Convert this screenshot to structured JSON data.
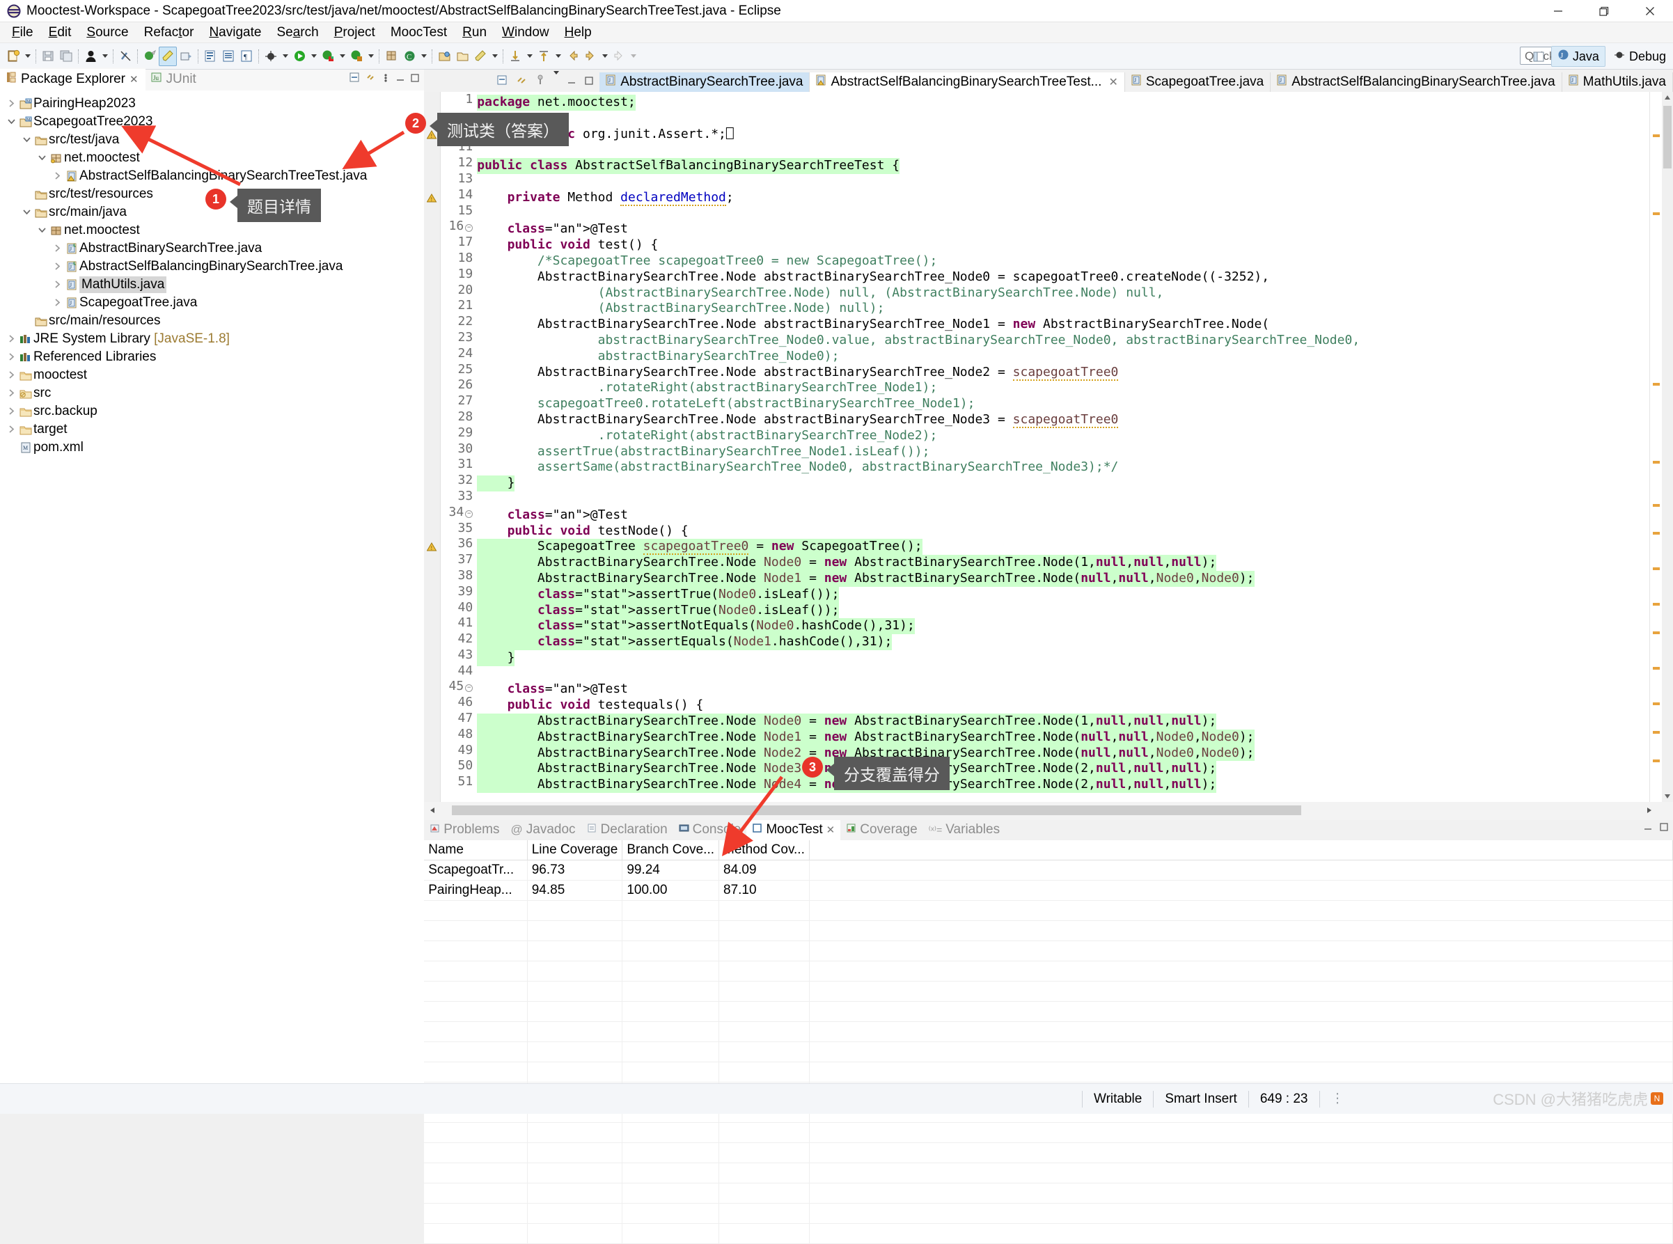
{
  "window": {
    "title": "Mooctest-Workspace - ScapegoatTree2023/src/test/java/net/mooctest/AbstractSelfBalancingBinarySearchTreeTest.java - Eclipse",
    "app_icon": "eclipse-icon",
    "minimize_label": "minimize-icon",
    "maximize_label": "maximize-icon",
    "close_label": "close-icon"
  },
  "menubar": {
    "items": [
      {
        "label": "File",
        "accel": "F"
      },
      {
        "label": "Edit",
        "accel": "E"
      },
      {
        "label": "Source",
        "accel": "S"
      },
      {
        "label": "Refactor",
        "accel": "t"
      },
      {
        "label": "Navigate",
        "accel": "N"
      },
      {
        "label": "Search",
        "accel": "a"
      },
      {
        "label": "Project",
        "accel": "P"
      },
      {
        "label": "MoocTest",
        "accel": ""
      },
      {
        "label": "Run",
        "accel": "R"
      },
      {
        "label": "Window",
        "accel": "W"
      },
      {
        "label": "Help",
        "accel": "H"
      }
    ]
  },
  "toolbar": {
    "quick_access_placeholder": "Quick Access",
    "perspectives": [
      {
        "label": "Java",
        "active": true,
        "icon": "java-perspective-icon"
      },
      {
        "label": "Debug",
        "active": false,
        "icon": "debug-perspective-icon"
      }
    ]
  },
  "left_pane": {
    "tabs": [
      {
        "label": "Package Explorer",
        "icon": "package-explorer-icon",
        "active": true,
        "closeable": true
      },
      {
        "label": "JUnit",
        "icon": "junit-icon",
        "active": false,
        "closeable": false
      }
    ],
    "tree": [
      {
        "indent": 0,
        "twist": "collapsed",
        "icon": "java-project-icon",
        "label": "PairingHeap2023",
        "selected": false
      },
      {
        "indent": 0,
        "twist": "expanded",
        "icon": "java-project-icon",
        "label": "ScapegoatTree2023",
        "selected": false
      },
      {
        "indent": 1,
        "twist": "expanded",
        "icon": "source-folder-icon",
        "label": "src/test/java",
        "selected": false
      },
      {
        "indent": 2,
        "twist": "expanded",
        "icon": "package-icon-test",
        "label": "net.mooctest",
        "selected": false
      },
      {
        "indent": 3,
        "twist": "collapsed",
        "icon": "java-file-warn-icon",
        "label": "AbstractSelfBalancingBinarySearchTreeTest.java",
        "selected": false
      },
      {
        "indent": 1,
        "twist": "none",
        "icon": "source-folder-icon",
        "label": "src/test/resources",
        "selected": false
      },
      {
        "indent": 1,
        "twist": "expanded",
        "icon": "source-folder-icon",
        "label": "src/main/java",
        "selected": false
      },
      {
        "indent": 2,
        "twist": "expanded",
        "icon": "package-icon",
        "label": "net.mooctest",
        "selected": false
      },
      {
        "indent": 3,
        "twist": "collapsed",
        "icon": "java-abstract-file-icon",
        "label": "AbstractBinarySearchTree.java",
        "selected": false
      },
      {
        "indent": 3,
        "twist": "collapsed",
        "icon": "java-abstract-file-icon",
        "label": "AbstractSelfBalancingBinarySearchTree.java",
        "selected": false
      },
      {
        "indent": 3,
        "twist": "collapsed",
        "icon": "java-file-icon",
        "label": "MathUtils.java",
        "selected": true
      },
      {
        "indent": 3,
        "twist": "collapsed",
        "icon": "java-file-icon",
        "label": "ScapegoatTree.java",
        "selected": false
      },
      {
        "indent": 1,
        "twist": "none",
        "icon": "source-folder-icon",
        "label": "src/main/resources",
        "selected": false
      },
      {
        "indent": 0,
        "twist": "collapsed",
        "icon": "library-icon",
        "label": "JRE System Library",
        "suffix": "[JavaSE-1.8]",
        "selected": false
      },
      {
        "indent": 0,
        "twist": "collapsed",
        "icon": "library-icon",
        "label": "Referenced Libraries",
        "selected": false
      },
      {
        "indent": 0,
        "twist": "collapsed",
        "icon": "folder-icon",
        "label": "mooctest",
        "selected": false
      },
      {
        "indent": 0,
        "twist": "collapsed",
        "icon": "folder-excluded-icon",
        "label": "src",
        "selected": false
      },
      {
        "indent": 0,
        "twist": "collapsed",
        "icon": "folder-icon",
        "label": "src.backup",
        "selected": false
      },
      {
        "indent": 0,
        "twist": "collapsed",
        "icon": "folder-icon",
        "label": "target",
        "selected": false
      },
      {
        "indent": 0,
        "twist": "none",
        "icon": "maven-pom-icon",
        "label": "pom.xml",
        "selected": false
      }
    ]
  },
  "editor": {
    "tabs": [
      {
        "label": "AbstractBinarySearchTree.java",
        "icon": "java-file-icon",
        "state": "selected-inactive",
        "closeable": false
      },
      {
        "label": "AbstractSelfBalancingBinarySearchTreeTest...",
        "icon": "java-file-warn-icon",
        "state": "active",
        "closeable": true
      },
      {
        "label": "ScapegoatTree.java",
        "icon": "java-file-icon",
        "state": "normal",
        "closeable": false
      },
      {
        "label": "AbstractSelfBalancingBinarySearchTree.java",
        "icon": "java-file-icon",
        "state": "normal",
        "closeable": false
      },
      {
        "label": "MathUtils.java",
        "icon": "java-file-icon",
        "state": "normal",
        "closeable": false
      }
    ],
    "lines": [
      {
        "n": "1",
        "fold": "",
        "mark": "",
        "hl": true,
        "code": "package net.mooctest;"
      },
      {
        "n": "",
        "fold": "",
        "mark": "",
        "hl": false,
        "code": ""
      },
      {
        "n": "3",
        "fold": "+",
        "mark": "warn",
        "hl": false,
        "code": "import static org.junit.Assert.*;⎕"
      },
      {
        "n": "11",
        "fold": "",
        "mark": "",
        "hl": false,
        "code": ""
      },
      {
        "n": "12",
        "fold": "",
        "mark": "",
        "hl": true,
        "code": "public class AbstractSelfBalancingBinarySearchTreeTest {"
      },
      {
        "n": "13",
        "fold": "",
        "mark": "",
        "hl": false,
        "code": ""
      },
      {
        "n": "14",
        "fold": "",
        "mark": "warn",
        "hl": false,
        "code": "    private Method declaredMethod;"
      },
      {
        "n": "15",
        "fold": "",
        "mark": "",
        "hl": false,
        "code": ""
      },
      {
        "n": "16",
        "fold": "-",
        "mark": "",
        "hl": false,
        "code": "    @Test"
      },
      {
        "n": "17",
        "fold": "",
        "mark": "",
        "hl": false,
        "code": "    public void test() {"
      },
      {
        "n": "18",
        "fold": "",
        "mark": "",
        "hl": false,
        "code": "        /*ScapegoatTree scapegoatTree0 = new ScapegoatTree();"
      },
      {
        "n": "19",
        "fold": "",
        "mark": "",
        "hl": false,
        "code": "        AbstractBinarySearchTree.Node abstractBinarySearchTree_Node0 = scapegoatTree0.createNode((-3252),"
      },
      {
        "n": "20",
        "fold": "",
        "mark": "",
        "hl": false,
        "code": "                (AbstractBinarySearchTree.Node) null, (AbstractBinarySearchTree.Node) null,"
      },
      {
        "n": "21",
        "fold": "",
        "mark": "",
        "hl": false,
        "code": "                (AbstractBinarySearchTree.Node) null);"
      },
      {
        "n": "22",
        "fold": "",
        "mark": "",
        "hl": false,
        "code": "        AbstractBinarySearchTree.Node abstractBinarySearchTree_Node1 = new AbstractBinarySearchTree.Node("
      },
      {
        "n": "23",
        "fold": "",
        "mark": "",
        "hl": false,
        "code": "                abstractBinarySearchTree_Node0.value, abstractBinarySearchTree_Node0, abstractBinarySearchTree_Node0,"
      },
      {
        "n": "24",
        "fold": "",
        "mark": "",
        "hl": false,
        "code": "                abstractBinarySearchTree_Node0);"
      },
      {
        "n": "25",
        "fold": "",
        "mark": "",
        "hl": false,
        "code": "        AbstractBinarySearchTree.Node abstractBinarySearchTree_Node2 = scapegoatTree0"
      },
      {
        "n": "26",
        "fold": "",
        "mark": "",
        "hl": false,
        "code": "                .rotateRight(abstractBinarySearchTree_Node1);"
      },
      {
        "n": "27",
        "fold": "",
        "mark": "",
        "hl": false,
        "code": "        scapegoatTree0.rotateLeft(abstractBinarySearchTree_Node1);"
      },
      {
        "n": "28",
        "fold": "",
        "mark": "",
        "hl": false,
        "code": "        AbstractBinarySearchTree.Node abstractBinarySearchTree_Node3 = scapegoatTree0"
      },
      {
        "n": "29",
        "fold": "",
        "mark": "",
        "hl": false,
        "code": "                .rotateRight(abstractBinarySearchTree_Node2);"
      },
      {
        "n": "30",
        "fold": "",
        "mark": "",
        "hl": false,
        "code": "        assertTrue(abstractBinarySearchTree_Node1.isLeaf());"
      },
      {
        "n": "31",
        "fold": "",
        "mark": "",
        "hl": false,
        "code": "        assertSame(abstractBinarySearchTree_Node0, abstractBinarySearchTree_Node3);*/"
      },
      {
        "n": "32",
        "fold": "",
        "mark": "",
        "hl": true,
        "code": "    }"
      },
      {
        "n": "33",
        "fold": "",
        "mark": "",
        "hl": false,
        "code": ""
      },
      {
        "n": "34",
        "fold": "-",
        "mark": "",
        "hl": false,
        "code": "    @Test"
      },
      {
        "n": "35",
        "fold": "",
        "mark": "",
        "hl": false,
        "code": "    public void testNode() {"
      },
      {
        "n": "36",
        "fold": "",
        "mark": "warn",
        "hl": true,
        "code": "        ScapegoatTree scapegoatTree0 = new ScapegoatTree();"
      },
      {
        "n": "37",
        "fold": "",
        "mark": "",
        "hl": true,
        "code": "        AbstractBinarySearchTree.Node Node0 = new AbstractBinarySearchTree.Node(1,null,null,null);"
      },
      {
        "n": "38",
        "fold": "",
        "mark": "",
        "hl": true,
        "code": "        AbstractBinarySearchTree.Node Node1 = new AbstractBinarySearchTree.Node(null,null,Node0,Node0);"
      },
      {
        "n": "39",
        "fold": "",
        "mark": "",
        "hl": true,
        "code": "        assertTrue(Node0.isLeaf());"
      },
      {
        "n": "40",
        "fold": "",
        "mark": "",
        "hl": true,
        "code": "        assertTrue(Node0.isLeaf());"
      },
      {
        "n": "41",
        "fold": "",
        "mark": "",
        "hl": true,
        "code": "        assertNotEquals(Node0.hashCode(),31);"
      },
      {
        "n": "42",
        "fold": "",
        "mark": "",
        "hl": true,
        "code": "        assertEquals(Node1.hashCode(),31);"
      },
      {
        "n": "43",
        "fold": "",
        "mark": "",
        "hl": true,
        "code": "    }"
      },
      {
        "n": "44",
        "fold": "",
        "mark": "",
        "hl": false,
        "code": ""
      },
      {
        "n": "45",
        "fold": "-",
        "mark": "",
        "hl": false,
        "code": "    @Test"
      },
      {
        "n": "46",
        "fold": "",
        "mark": "",
        "hl": false,
        "code": "    public void testequals() {"
      },
      {
        "n": "47",
        "fold": "",
        "mark": "",
        "hl": true,
        "code": "        AbstractBinarySearchTree.Node Node0 = new AbstractBinarySearchTree.Node(1,null,null,null);"
      },
      {
        "n": "48",
        "fold": "",
        "mark": "",
        "hl": true,
        "code": "        AbstractBinarySearchTree.Node Node1 = new AbstractBinarySearchTree.Node(null,null,Node0,Node0);"
      },
      {
        "n": "49",
        "fold": "",
        "mark": "",
        "hl": true,
        "code": "        AbstractBinarySearchTree.Node Node2 = new AbstractBinarySearchTree.Node(null,null,Node0,Node0);"
      },
      {
        "n": "50",
        "fold": "",
        "mark": "",
        "hl": true,
        "code": "        AbstractBinarySearchTree.Node Node3 = new AbstractBinarySearchTree.Node(2,null,null,null);"
      },
      {
        "n": "51",
        "fold": "",
        "mark": "",
        "hl": true,
        "code": "        AbstractBinarySearchTree.Node Node4 = new AbstractBinarySearchTree.Node(2,null,null,null);"
      }
    ]
  },
  "bottom_pane": {
    "tabs": [
      {
        "label": "Problems",
        "icon": "problems-icon",
        "active": false,
        "closeable": false
      },
      {
        "label": "Javadoc",
        "icon": "javadoc-icon",
        "active": false,
        "closeable": false
      },
      {
        "label": "Declaration",
        "icon": "declaration-icon",
        "active": false,
        "closeable": false
      },
      {
        "label": "Console",
        "icon": "console-icon",
        "active": false,
        "closeable": false
      },
      {
        "label": "MoocTest",
        "icon": "mooctest-icon",
        "active": true,
        "closeable": true
      },
      {
        "label": "Coverage",
        "icon": "coverage-icon",
        "active": false,
        "closeable": false
      },
      {
        "label": "Variables",
        "icon": "variables-icon",
        "active": false,
        "closeable": false
      }
    ],
    "table": {
      "columns": [
        "Name",
        "Line Coverage",
        "Branch Cove...",
        "Method Cov...",
        ""
      ],
      "rows": [
        [
          "ScapegoatTr...",
          "96.73",
          "99.24",
          "84.09",
          ""
        ],
        [
          "PairingHeap...",
          "94.85",
          "100.00",
          "87.10",
          ""
        ]
      ]
    }
  },
  "statusbar": {
    "writable": "Writable",
    "insert_mode": "Smart Insert",
    "position": "649 : 23",
    "watermark": "CSDN @大猪猪吃虎虎"
  },
  "annotations": [
    {
      "id": "1",
      "text": "题目详情"
    },
    {
      "id": "2",
      "text": "测试类（答案）"
    },
    {
      "id": "3",
      "text": "分支覆盖得分"
    }
  ],
  "colors": {
    "accent": "#e8342a",
    "callout_bg": "#595959",
    "highlight_green": "#ccffcc",
    "keyword": "#7f0055",
    "comment": "#3f7f5f",
    "string": "#2a00ff",
    "field": "#0000c0"
  }
}
